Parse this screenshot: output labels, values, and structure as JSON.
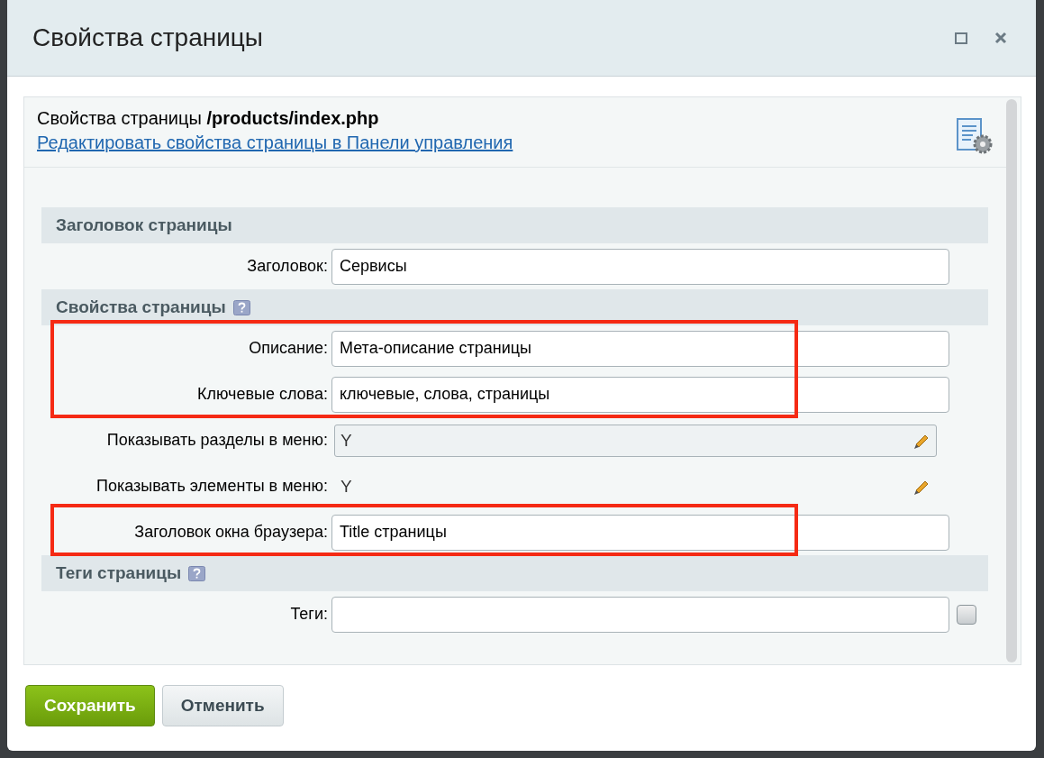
{
  "window": {
    "title": "Свойства страницы"
  },
  "header": {
    "caption": "Свойства страницы **/products/index.php**",
    "link": "Редактировать свойства страницы в Панели управления"
  },
  "sections": [
    {
      "title": "Заголовок страницы",
      "help": false,
      "fields": [
        {
          "kind": "text",
          "label": "Заголовок:",
          "value": "Сервисы",
          "annotated": false
        }
      ]
    },
    {
      "title": "Свойства страницы",
      "help": true,
      "fields": [
        {
          "kind": "text",
          "label": "Описание:",
          "value": "Мета-описание страницы",
          "annotated": true
        },
        {
          "kind": "text",
          "label": "Ключевые слова:",
          "value": "ключевые, слова, страницы",
          "annotated": true
        },
        {
          "kind": "readonly",
          "label": "Показывать разделы в меню:",
          "value": "Y",
          "hovered": true,
          "annotated": false
        },
        {
          "kind": "readonly",
          "label": "Показывать элементы в меню:",
          "value": "Y",
          "hovered": false,
          "annotated": false
        },
        {
          "kind": "text",
          "label": "Заголовок окна браузера:",
          "value": "Title страницы",
          "annotated": true
        }
      ]
    },
    {
      "title": "Теги страницы",
      "help": true,
      "fields": [
        {
          "kind": "tags",
          "label": "Теги:",
          "checked": false,
          "annotated": false
        }
      ]
    }
  ],
  "buttons": [
    {
      "kind": "primary",
      "label": "Сохранить"
    },
    {
      "kind": "secondary",
      "label": "Отменить"
    }
  ]
}
